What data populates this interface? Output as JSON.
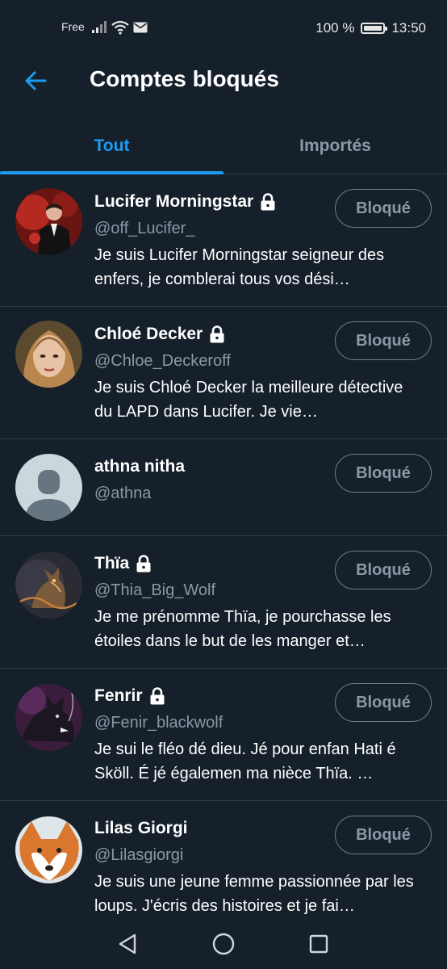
{
  "status_bar": {
    "carrier": "Free",
    "battery": "100 %",
    "time": "13:50",
    "icons": [
      "signal-icon",
      "wifi-icon",
      "mail-icon",
      "battery-icon"
    ]
  },
  "header": {
    "title": "Comptes bloqués",
    "back_icon": "back-arrow-icon"
  },
  "tabs": [
    {
      "label": "Tout",
      "active": true
    },
    {
      "label": "Importés",
      "active": false
    }
  ],
  "accounts": [
    {
      "name": "Lucifer Morningstar",
      "handle": "@off_Lucifer_",
      "locked": true,
      "bio": "Je suis Lucifer Morningstar seigneur des enfers, je comblerai tous vos dési…",
      "button": "Bloqué"
    },
    {
      "name": "Chloé Decker",
      "handle": "@Chloe_Deckeroff",
      "locked": true,
      "bio": "Je suis Chloé Decker la meilleure détective du LAPD dans Lucifer. Je vie…",
      "button": "Bloqué"
    },
    {
      "name": "athna nitha",
      "handle": "@athna",
      "locked": false,
      "bio": "",
      "button": "Bloqué"
    },
    {
      "name": "Thïa",
      "handle": "@Thia_Big_Wolf",
      "locked": true,
      "bio": "Je me prénomme Thïa, je pourchasse les étoiles dans le but de les manger et…",
      "button": "Bloqué"
    },
    {
      "name": "Fenrir",
      "handle": "@Fenir_blackwolf",
      "locked": true,
      "bio": "Je sui le fléo dé dieu. Jé pour enfan Hati é Sköll. É jé égalemen ma nièce Thïa. …",
      "button": "Bloqué"
    },
    {
      "name": "Lilas Giorgi",
      "handle": "@Lilasgiorgi",
      "locked": false,
      "bio": "Je suis une jeune femme passionnée par les loups. J'écris des histoires et je fai…",
      "button": "Bloqué"
    }
  ],
  "colors": {
    "background": "#15202b",
    "accent": "#1d9bf0",
    "secondary_text": "#8b98a5",
    "divider": "#2f3d4a"
  },
  "navbar": {
    "icons": [
      "back-triangle-icon",
      "home-circle-icon",
      "recents-square-icon"
    ]
  }
}
